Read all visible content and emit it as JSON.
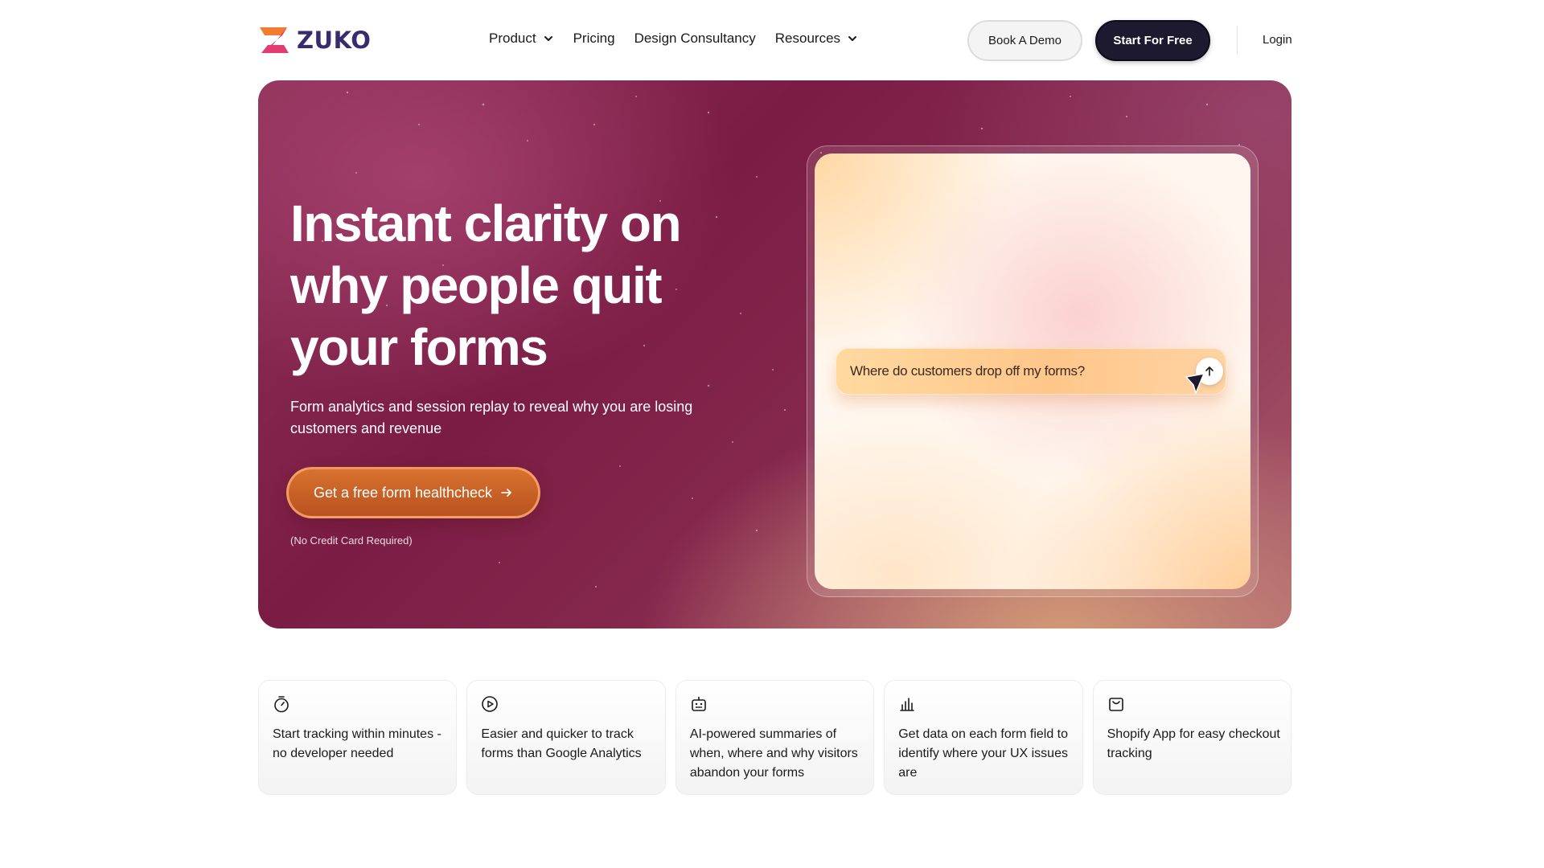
{
  "brand": {
    "name": "ZUKO",
    "colors": {
      "primary_dark": "#1d1a30",
      "hero_base": "#7a1c44",
      "cta": "#c8622a",
      "logo_pink": "#e6336d",
      "logo_orange": "#f47c32"
    }
  },
  "nav": {
    "items": [
      {
        "label": "Product",
        "has_dropdown": true
      },
      {
        "label": "Pricing",
        "has_dropdown": false
      },
      {
        "label": "Design Consultancy",
        "has_dropdown": false
      },
      {
        "label": "Resources",
        "has_dropdown": true
      }
    ],
    "book_demo": "Book A Demo",
    "start_free": "Start For Free",
    "login": "Login"
  },
  "hero": {
    "title": "Instant clarity on why people quit your forms",
    "subtitle": "Form analytics and session replay to reveal why you are losing customers and revenue",
    "cta_label": "Get a free form healthcheck",
    "cta_note": "(No Credit Card Required)",
    "preview": {
      "query": "Where do customers drop off my forms?"
    }
  },
  "features": [
    {
      "icon": "stopwatch-icon",
      "text": "Start tracking within minutes - no developer needed"
    },
    {
      "icon": "play-circle-icon",
      "text": "Easier and quicker to track forms than Google Analytics"
    },
    {
      "icon": "robot-icon",
      "text": "AI-powered summaries of when, where and why visitors abandon your forms"
    },
    {
      "icon": "bar-chart-icon",
      "text": "Get data on each form field to identify where your UX issues are"
    },
    {
      "icon": "shopping-bag-icon",
      "text": "Shopify App for easy checkout tracking"
    }
  ]
}
